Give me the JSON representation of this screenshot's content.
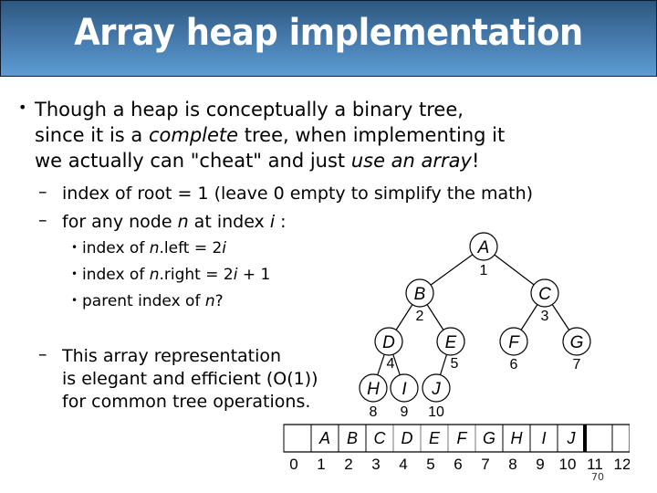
{
  "title": "Array heap implementation",
  "bullets": {
    "main": {
      "line1": "Though a heap is conceptually a binary tree,",
      "line2_pre": "since it is a ",
      "line2_em": "complete",
      "line2_post": " tree, when implementing it",
      "line3_pre": "we actually can \"cheat\" and just ",
      "line3_em": "use an array",
      "line3_post": "!"
    },
    "sub1": "index of root = 1  (leave 0 empty to simplify the math)",
    "sub2": {
      "pre": "for any node ",
      "n": "n",
      "mid": " at index ",
      "i": "i",
      "post": " :"
    },
    "sub2_items": [
      {
        "pre": "index of ",
        "n": "n",
        "post": ".left   = 2",
        "i": "i",
        "tail": ""
      },
      {
        "pre": "index of ",
        "n": "n",
        "post": ".right = 2",
        "i": "i",
        "tail": " + 1"
      },
      {
        "pre": "parent index of ",
        "n": "n",
        "post": "?",
        "i": "",
        "tail": ""
      }
    ],
    "sub3": {
      "line1": "This array representation",
      "line2": "is elegant and efficient (O(1))",
      "line3": "for common tree operations."
    },
    "bullet_glyph": "•",
    "dash_glyph": "–"
  },
  "tree": {
    "nodes": [
      {
        "label": "A",
        "index": "1"
      },
      {
        "label": "B",
        "index": "2"
      },
      {
        "label": "C",
        "index": "3"
      },
      {
        "label": "D",
        "index": "4"
      },
      {
        "label": "E",
        "index": "5"
      },
      {
        "label": "F",
        "index": "6"
      },
      {
        "label": "G",
        "index": "7"
      },
      {
        "label": "H",
        "index": "8"
      },
      {
        "label": "I",
        "index": "9"
      },
      {
        "label": "J",
        "index": "10"
      }
    ]
  },
  "array": {
    "cells": [
      "",
      "A",
      "B",
      "C",
      "D",
      "E",
      "F",
      "G",
      "H",
      "I",
      "J",
      "",
      ""
    ],
    "indices": [
      "0",
      "1",
      "2",
      "3",
      "4",
      "5",
      "6",
      "7",
      "8",
      "9",
      "10",
      "11",
      "12"
    ],
    "end_marker_after_index": 10
  },
  "page_number": "70"
}
